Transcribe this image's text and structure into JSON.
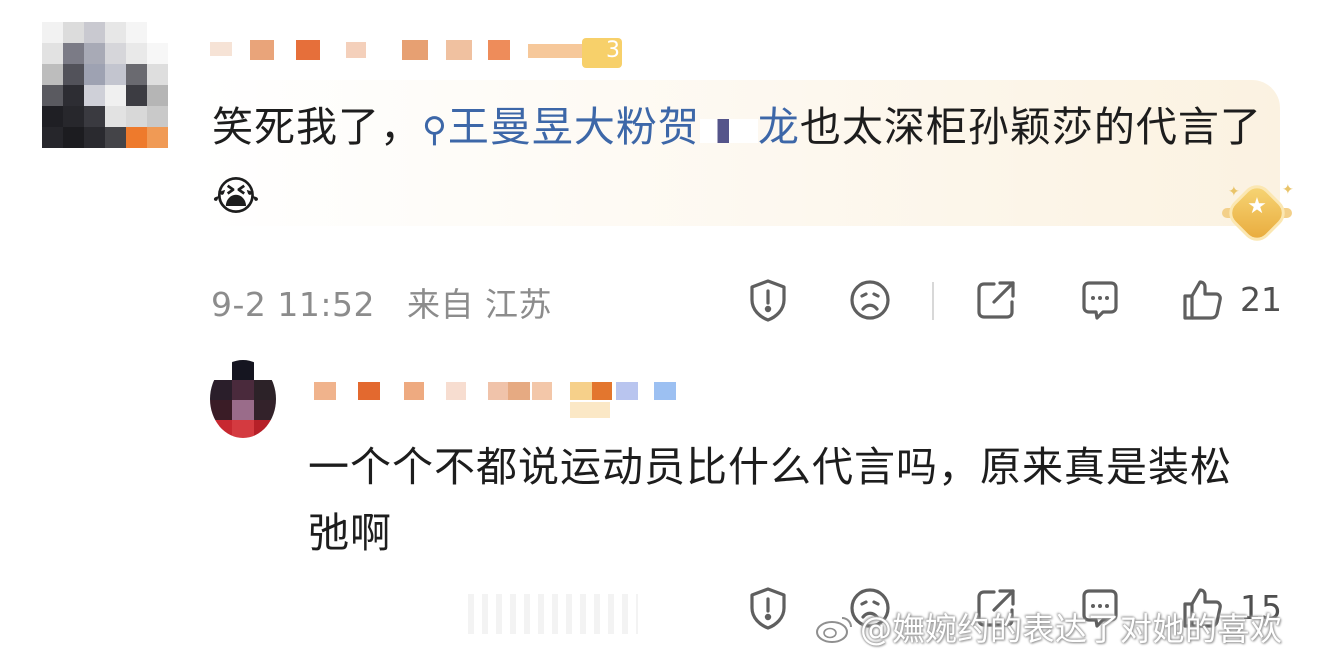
{
  "comment": {
    "text_before_mention": "笑死我了，",
    "mention_text": "王曼昱大粉贺",
    "mention_tail": "龙",
    "text_after_mention": "也太深柜孙颖莎的代言了",
    "emoji": "😭",
    "date": "9-2 11:52",
    "source": "来自 江苏",
    "like_count": "21",
    "user_badge_level": "3"
  },
  "reply": {
    "text": "一个个不都说运动员比什么代言吗，原来真是装松弛啊",
    "like_count": "15"
  },
  "icons": {
    "report": "report-icon",
    "dislike": "dislike-icon",
    "share": "share-icon",
    "comment": "comment-icon",
    "like": "thumbs-up-icon",
    "search": "search-icon",
    "badge": "medal-icon"
  },
  "watermark": {
    "text": "@嫵婉约的表达了对她的喜欢"
  },
  "colors": {
    "mention": "#3d67a8",
    "meta": "#8c8c8c",
    "text": "#1d1d1d"
  }
}
